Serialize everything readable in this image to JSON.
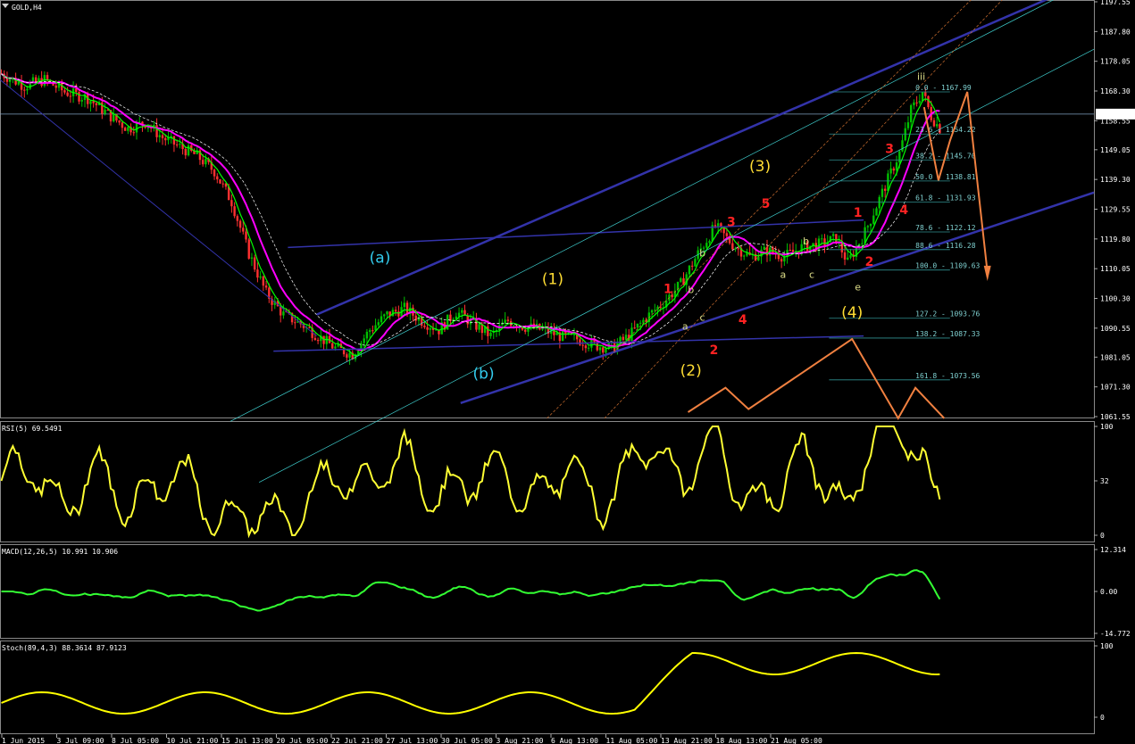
{
  "window": {
    "title": "GOLD,H4"
  },
  "colors": {
    "background": "#000000",
    "bull_candle": "#00c000",
    "bear_candle": "#ff3030",
    "ma_fast": "#ff00ff",
    "ma_slow": "#00ff00",
    "channel": "#3333aa",
    "forecast": "#f08040",
    "fib": "#2f8f8f",
    "rsi": "#ffff33",
    "macd_hist": "#1010ff",
    "stoch_main": "#ffff00"
  },
  "chart_data": [
    {
      "type": "candlestick",
      "title": "GOLD,H4",
      "ylim": [
        1061.55,
        1197.55
      ],
      "y_ticks": [
        "1197.55",
        "1187.80",
        "1178.05",
        "1168.30",
        "1158.55",
        "1149.05",
        "1139.30",
        "1129.55",
        "1119.80",
        "1110.05",
        "1100.30",
        "1090.55",
        "1081.05",
        "1071.30",
        "1061.55"
      ],
      "current_price": "1160.74",
      "x_ticks": [
        "1 Jun 2015",
        "3 Jul 09:00",
        "8 Jul 05:00",
        "10 Jul 21:00",
        "15 Jul 13:00",
        "20 Jul 05:00",
        "22 Jul 21:00",
        "27 Jul 13:00",
        "30 Jul 05:00",
        "3 Aug 21:00",
        "6 Aug 13:00",
        "11 Aug 05:00",
        "13 Aug 21:00",
        "18 Aug 13:00",
        "21 Aug 05:00"
      ],
      "price_path": [
        [
          0,
          1174
        ],
        [
          8,
          1170
        ],
        [
          15,
          1172
        ],
        [
          22,
          1168
        ],
        [
          30,
          1166
        ],
        [
          38,
          1160
        ],
        [
          44,
          1156
        ],
        [
          50,
          1158
        ],
        [
          56,
          1153
        ],
        [
          62,
          1150
        ],
        [
          68,
          1147
        ],
        [
          74,
          1142
        ],
        [
          80,
          1132
        ],
        [
          86,
          1115
        ],
        [
          92,
          1102
        ],
        [
          98,
          1095
        ],
        [
          104,
          1092
        ],
        [
          110,
          1088
        ],
        [
          116,
          1084
        ],
        [
          122,
          1082
        ],
        [
          128,
          1090
        ],
        [
          134,
          1095
        ],
        [
          140,
          1097
        ],
        [
          146,
          1093
        ],
        [
          152,
          1090
        ],
        [
          158,
          1096
        ],
        [
          164,
          1092
        ],
        [
          170,
          1088
        ],
        [
          176,
          1093
        ],
        [
          182,
          1091
        ],
        [
          188,
          1090
        ],
        [
          194,
          1088
        ],
        [
          200,
          1087
        ],
        [
          206,
          1085
        ],
        [
          212,
          1084
        ],
        [
          218,
          1088
        ],
        [
          224,
          1094
        ],
        [
          230,
          1099
        ],
        [
          236,
          1105
        ],
        [
          242,
          1115
        ],
        [
          248,
          1124
        ],
        [
          254,
          1118
        ],
        [
          260,
          1114
        ],
        [
          266,
          1116
        ],
        [
          272,
          1114
        ],
        [
          278,
          1117
        ],
        [
          284,
          1118
        ],
        [
          290,
          1120
        ],
        [
          294,
          1112
        ],
        [
          300,
          1122
        ],
        [
          306,
          1135
        ],
        [
          312,
          1148
        ],
        [
          316,
          1162
        ],
        [
          320,
          1168
        ],
        [
          323,
          1160
        ],
        [
          326,
          1156
        ]
      ],
      "waves": [
        {
          "text": "(a)",
          "x": 132,
          "y": 1112,
          "color": "#33ccee"
        },
        {
          "text": "(b)",
          "x": 168,
          "y": 1074,
          "color": "#33ccee"
        },
        {
          "text": "(1)",
          "x": 192,
          "y": 1105,
          "color": "#ffdd33"
        },
        {
          "text": "(2)",
          "x": 240,
          "y": 1075,
          "color": "#ffdd33"
        },
        {
          "text": "(3)",
          "x": 264,
          "y": 1142,
          "color": "#ffdd33"
        },
        {
          "text": "(4)",
          "x": 296,
          "y": 1094,
          "color": "#ffdd33"
        },
        {
          "text": "1",
          "x": 232,
          "y": 1102,
          "color": "#ff2222"
        },
        {
          "text": "2",
          "x": 248,
          "y": 1082,
          "color": "#ff2222"
        },
        {
          "text": "3",
          "x": 254,
          "y": 1124,
          "color": "#ff2222"
        },
        {
          "text": "4",
          "x": 258,
          "y": 1092,
          "color": "#ff2222"
        },
        {
          "text": "5",
          "x": 266,
          "y": 1130,
          "color": "#ff2222"
        },
        {
          "text": "1",
          "x": 298,
          "y": 1127,
          "color": "#ff2222"
        },
        {
          "text": "2",
          "x": 302,
          "y": 1111,
          "color": "#ff2222"
        },
        {
          "text": "3",
          "x": 309,
          "y": 1148,
          "color": "#ff2222"
        },
        {
          "text": "4",
          "x": 314,
          "y": 1128,
          "color": "#ff2222"
        },
        {
          "text": "a",
          "x": 238,
          "y": 1090,
          "color": "#dddd88"
        },
        {
          "text": "b",
          "x": 244,
          "y": 1114,
          "color": "#dddd88"
        },
        {
          "text": "b",
          "x": 240,
          "y": 1102,
          "color": "#dddd88"
        },
        {
          "text": "c",
          "x": 244,
          "y": 1093,
          "color": "#dddd88"
        },
        {
          "text": "a",
          "x": 272,
          "y": 1107,
          "color": "#dddd88"
        },
        {
          "text": "b",
          "x": 280,
          "y": 1118,
          "color": "#dddd88"
        },
        {
          "text": "c",
          "x": 282,
          "y": 1107,
          "color": "#dddd88"
        },
        {
          "text": "e",
          "x": 298,
          "y": 1103,
          "color": "#dddd88"
        },
        {
          "text": "iii",
          "x": 320,
          "y": 1172,
          "color": "#dddd88"
        }
      ],
      "fib_levels": [
        {
          "label": "0.0 - 1167.99",
          "price": 1168.0
        },
        {
          "label": "23.6 - 1154.22",
          "price": 1154.2
        },
        {
          "label": "38.2 - 1145.70",
          "price": 1145.7
        },
        {
          "label": "50.0 - 1138.81",
          "price": 1138.8
        },
        {
          "label": "61.8 - 1131.93",
          "price": 1131.9
        },
        {
          "label": "78.6 - 1122.12",
          "price": 1122.1
        },
        {
          "label": "88.6 - 1116.28",
          "price": 1116.3
        },
        {
          "label": "100.0 - 1109.63",
          "price": 1109.6
        },
        {
          "label": "127.2 - 1093.76",
          "price": 1093.8
        },
        {
          "label": "138.2 - 1087.33",
          "price": 1087.3
        },
        {
          "label": "161.8 - 1073.56",
          "price": 1073.6
        }
      ]
    },
    {
      "type": "line",
      "title": "RSI(5) 69.5491",
      "ylim": [
        0,
        100
      ],
      "y_ticks": [
        "100",
        "32",
        "0"
      ]
    },
    {
      "type": "line",
      "title": "MACD(12,26,5) 10.991 10.906",
      "y_ticks": [
        "12.314",
        "0.00",
        "-14.772"
      ]
    },
    {
      "type": "line",
      "title": "Stoch(89,4,3) 88.3614 87.9123",
      "ylim": [
        0,
        100
      ],
      "y_ticks": [
        "100",
        "0"
      ]
    }
  ]
}
